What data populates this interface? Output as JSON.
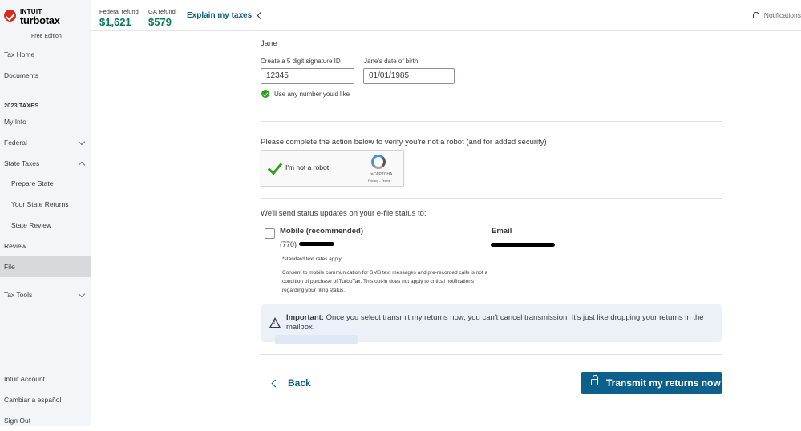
{
  "brand": {
    "intuit": "INTUIT",
    "turbotax": "turbotax",
    "edition": "Free Edition"
  },
  "header": {
    "federal_refund_label": "Federal refund",
    "federal_refund_amount": "$1,621",
    "ga_refund_label": "GA refund",
    "ga_refund_amount": "$579",
    "explain_label": "Explain my taxes",
    "notifications_label": "Notifications"
  },
  "sidebar": {
    "tax_home": "Tax Home",
    "documents": "Documents",
    "section_heading": "2023 TAXES",
    "my_info": "My Info",
    "federal": "Federal",
    "state_taxes": "State Taxes",
    "prepare_state": "Prepare State",
    "your_state_returns": "Your State Returns",
    "state_review": "State Review",
    "review": "Review",
    "file": "File",
    "tax_tools": "Tax Tools",
    "intuit_account": "Intuit Account",
    "cambiar": "Cambiar a español",
    "sign_out": "Sign Out"
  },
  "form": {
    "taxpayer_name": "Jane",
    "signature_label": "Create a 5 digit signature ID",
    "signature_value": "12345",
    "dob_label": "Jane's date of birth",
    "dob_value": "01/01/1985",
    "hint": "Use any number you'd like"
  },
  "captcha": {
    "prompt": "Please complete the action below to verify you're not a robot (and for added security)",
    "label": "I'm not a robot",
    "brand": "reCAPTCHA",
    "terms": "Privacy - Terms"
  },
  "status": {
    "heading": "We'll send status updates on your e-file status to:",
    "mobile_label": "Mobile (recommended)",
    "mobile_prefix": "(770)",
    "email_label": "Email",
    "rates_note": "*standard text rates apply",
    "consent": "Consent to mobile communication for SMS text messages and pre-recorded calls is not a condition of purchase of TurboTax. This opt-in does not apply to critical notifications regarding your filing status."
  },
  "important": {
    "label": "Important:",
    "text": "Once you select transmit my returns now, you can't cancel transmission. It's just like dropping your returns in the mailbox."
  },
  "footer": {
    "back_label": "Back",
    "transmit_label": "Transmit my returns now"
  },
  "colors": {
    "brand_blue": "#0d5f8c",
    "refund_green": "#0a7a5c",
    "success_green": "#2ca01c",
    "brand_red": "#d52b1e"
  }
}
